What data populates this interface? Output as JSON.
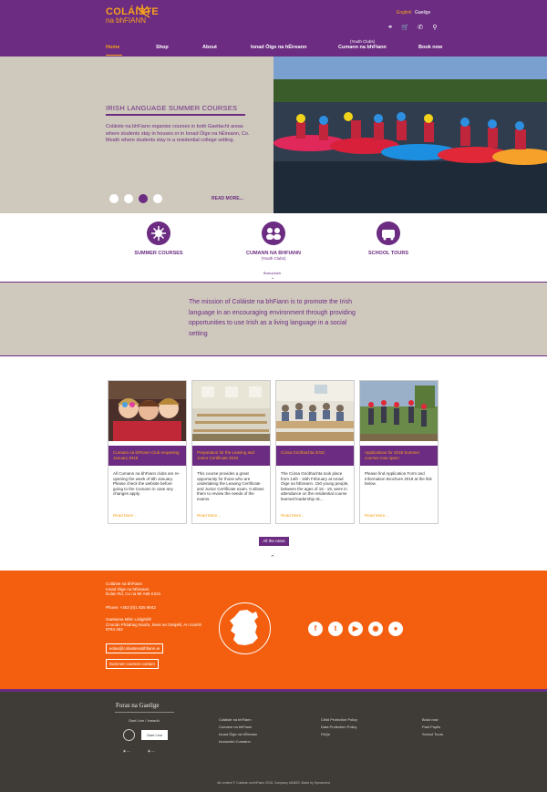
{
  "header": {
    "logo_line1": "COLÁISTE",
    "logo_line2": "na bhFIANN",
    "lang_english": "English",
    "lang_gaeilge": "Gaeilge",
    "nav": [
      "Home",
      "Shop",
      "About",
      "Ionad Óige na hÉireann",
      "Cumann na bhFiann",
      "Book now"
    ],
    "nav_superscript": "(Youth Clubs)"
  },
  "hero": {
    "title": "IRISH LANGUAGE SUMMER COURSES",
    "text": "Coláiste na bhFiann organise courses in both Gaeltacht areas where students stay in houses or in Ionad Óige na hÉireann, Co. Meath where students stay in a residential college setting.",
    "read_more": "READ MORE..."
  },
  "features": [
    {
      "label": "SUMMER COURSES",
      "sub": ""
    },
    {
      "label": "CUMANN NA BHFIANN",
      "sub": "(Youth Clubs)"
    },
    {
      "label": "SCHOOL TOURS",
      "sub": ""
    }
  ],
  "features_more": "Buaicphointí",
  "mission": "The mission of Coláiste na bhFiann is to promote the Irish language in an encouraging environment through providing opportunities to use Irish as a living language in a social setting",
  "news": [
    {
      "title": "Cumann na bhFiann Club reopening January 2018",
      "body": "All Cumann na bhFiann clubs are re-opening the week of 8th January. Please check the website before going to the Cumann in case any changes apply.",
      "read_more": "Read More..."
    },
    {
      "title": "Preparation for the Leaving and Junior Certificate 2018",
      "body": "This course provides a great opportunity for those who are undertaking the Leaving Certificate and Junior Certificate exam. It allows them to review the needs of the exams.",
      "read_more": "Read More..."
    },
    {
      "title": "Cúrsa Gnóthachta 2018",
      "body": "The Cúrsa Gnóthachta took place from 14th - 16th February at Ionad Óige na hÉireann. 150 young people, between the ages of 15 - 19, were in attendance on the residential course learned leadership sk...",
      "read_more": "Read More..."
    },
    {
      "title": "Applications for 2018 Summer courses now open!",
      "body": "Please find Application Form and Information Brochure 2018 at the link below.",
      "read_more": "Read More..."
    }
  ],
  "all_news": "All the news",
  "footer_orange": {
    "address": [
      "Coláiste na bhFiann",
      "Ionad Óige na hÉireann",
      "Dolan Rd, Co na Mí A65 K221"
    ],
    "phone": "Phone: +353 (0)1 825 9042",
    "charity": [
      "Gaelanna Mhic Lúdghéill",
      "Cnocán Phádraig Naofa, Seas an tSeipéil, An Uaimh",
      "8784 252"
    ],
    "email_btn": "eolas@colaistenabhfiann.ie",
    "contact_btn": "Summer courses contact",
    "social": [
      "facebook-icon",
      "twitter-icon",
      "youtube-icon",
      "instagram-icon",
      "snapchat-icon"
    ]
  },
  "footer_dark": {
    "foras": "Foras na Gaeilge",
    "gael_text": "Gael Linn / Iomadú",
    "logo_box": "Gael Linn",
    "col1": [
      "Coláiste na bhFiann",
      "Cumann na bhFiann",
      "Ionad Óige na hÉireann",
      "Ionduchtú Cumainn"
    ],
    "col2": [
      "Child Protection Policy",
      "Data Protection Policy",
      "FAQs"
    ],
    "col3": [
      "Book now",
      "Past Pupils",
      "School Tours"
    ],
    "copyright": "All content © Coláiste na bhFiann 2018, Company #64820. Made by Spearmind"
  },
  "colors": {
    "purple": "#6b2c81",
    "orange": "#f35f0f",
    "gold": "#f7a21b",
    "beige": "#cfc8bd",
    "dark": "#3f3c37"
  }
}
